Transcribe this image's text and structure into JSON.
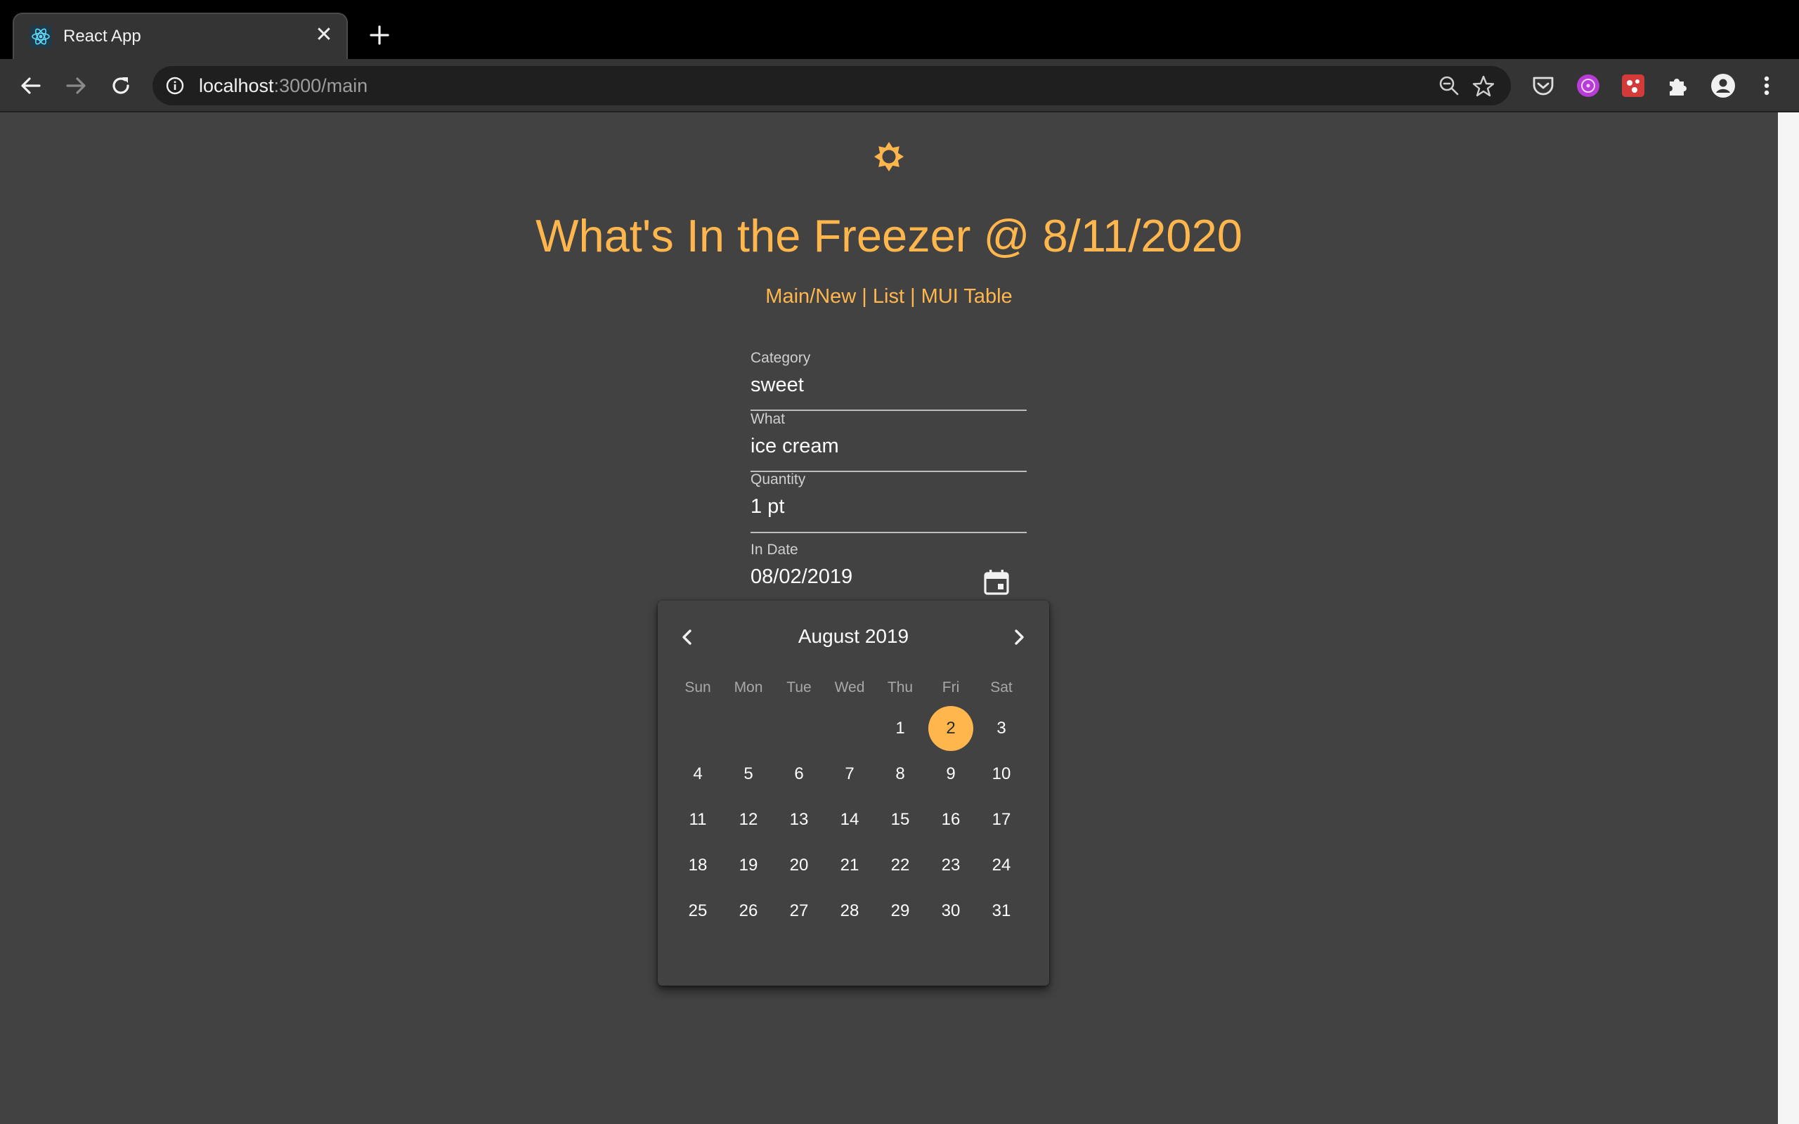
{
  "browser": {
    "tab_title": "React App",
    "url_host": "localhost",
    "url_path": ":3000/main"
  },
  "page": {
    "title": "What's In the Freezer @ 8/11/2020",
    "nav": {
      "main_new": "Main/New",
      "sep1": " | ",
      "list": "List",
      "sep2": " | ",
      "mui_table": "MUI Table"
    }
  },
  "form": {
    "category": {
      "label": "Category",
      "value": "sweet"
    },
    "what": {
      "label": "What",
      "value": "ice cream"
    },
    "quantity": {
      "label": "Quantity",
      "value": "1 pt"
    },
    "in_date": {
      "label": "In Date",
      "value": "08/02/2019"
    }
  },
  "datepicker": {
    "month_label": "August 2019",
    "weekdays": [
      "Sun",
      "Mon",
      "Tue",
      "Wed",
      "Thu",
      "Fri",
      "Sat"
    ],
    "first_weekday_index": 4,
    "days_in_month": 31,
    "selected_day": 2
  },
  "colors": {
    "accent": "#ffb74d",
    "background": "#424242"
  }
}
